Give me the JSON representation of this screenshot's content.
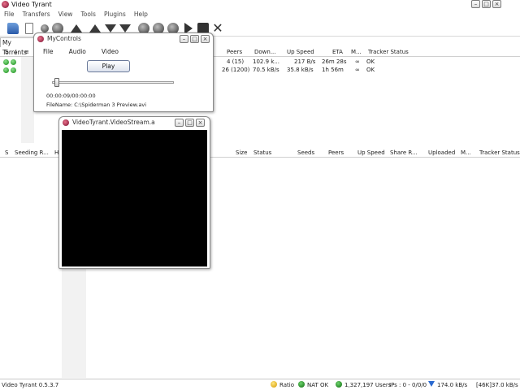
{
  "app": {
    "title": "Video Tyrant",
    "version": "Video Tyrant 0.5.3.7"
  },
  "window_controls": {
    "minimize": "–",
    "maximize": "□",
    "close": "×"
  },
  "menubar": {
    "items": [
      "File",
      "Transfers",
      "View",
      "Tools",
      "Plugins",
      "Help"
    ]
  },
  "toolbar": {
    "icons": [
      "open-folder",
      "new-document",
      "disc",
      "rss",
      "move-up",
      "move-top",
      "move-down",
      "move-bottom",
      "refresh",
      "stop",
      "globe",
      "play",
      "square",
      "remove"
    ]
  },
  "tab": {
    "label": "My Torrents"
  },
  "top_table": {
    "headers": [
      "S",
      "↓",
      "≡",
      "Peers",
      "Down...",
      "Up Speed",
      "ETA",
      "M...",
      "Tracker Status"
    ],
    "rows": [
      {
        "peers": "4 (15)",
        "down": "102.9 k...",
        "up": "217 B/s",
        "eta": "26m 28s",
        "m": "∞",
        "tracker": "OK"
      },
      {
        "peers": "26 (1200)",
        "down": "70.5 kB/s",
        "up": "35.8 kB/s",
        "eta": "1h 56m",
        "m": "∞",
        "tracker": "OK"
      }
    ]
  },
  "bottom_table": {
    "headers": [
      "S",
      "Seeding R...",
      "H",
      "Size",
      "Status",
      "Seeds",
      "Peers",
      "Up Speed",
      "Share R...",
      "Uploaded",
      "M...",
      "Tracker Status"
    ]
  },
  "mycontrols": {
    "title": "MyControls",
    "menu": [
      "File",
      "Audio",
      "Video"
    ],
    "play_label": "Play",
    "time": "00:00:09/00:00:00",
    "filename": "FileName: C:\\Spiderman 3 Preview.avi",
    "slider_position": 0.02
  },
  "videostream": {
    "title": "VideoTyrant.VideoStream.a"
  },
  "statusbar": {
    "ratio": "Ratio",
    "nat": "NAT OK",
    "users": "1,327,197 Users",
    "ips": "IPs : 0 - 0/0/0",
    "down_speed": "174.0 kB/s",
    "up_speed": "[46K]37.0 kB/s",
    "colors": {
      "ratio": "#e0b000",
      "nat": "#0a7a0a",
      "users": "#0a7a0a",
      "down": "#2a6ad0"
    }
  }
}
